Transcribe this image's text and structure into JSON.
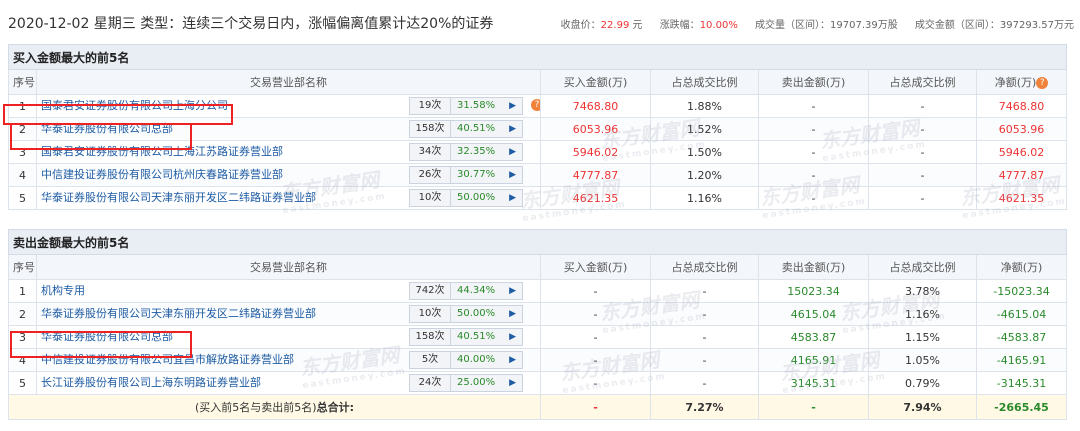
{
  "header": {
    "title": "2020-12-02 星期三  类型：连续三个交易日内，涨幅偏离值累计达20%的证券",
    "close_label": "收盘价：",
    "close_value": "22.99",
    "close_unit": "元",
    "change_label": "涨跌幅：",
    "change_value": "10.00%",
    "volume_label": "成交量（区间）：19707.39万股",
    "amount_label": "成交金额（区间）：397293.57万元"
  },
  "buy": {
    "section_title": "买入金额最大的前5名",
    "columns": [
      "序号",
      "交易营业部名称",
      "买入金额(万)",
      "占总成交比例",
      "卖出金额(万)",
      "占总成交比例",
      "净额(万)"
    ],
    "rows": [
      {
        "no": "1",
        "name": "国泰君安证券股份有限公司上海分公司",
        "count": "19次",
        "pct": "31.58%",
        "buy": "7468.80",
        "buy_ratio": "1.88%",
        "sell": "-",
        "sell_ratio": "-",
        "net": "7468.80"
      },
      {
        "no": "2",
        "name": "华泰证券股份有限公司总部",
        "count": "158次",
        "pct": "40.51%",
        "buy": "6053.96",
        "buy_ratio": "1.52%",
        "sell": "-",
        "sell_ratio": "-",
        "net": "6053.96"
      },
      {
        "no": "3",
        "name": "国泰君安证券股份有限公司上海江苏路证券营业部",
        "count": "34次",
        "pct": "32.35%",
        "buy": "5946.02",
        "buy_ratio": "1.50%",
        "sell": "-",
        "sell_ratio": "-",
        "net": "5946.02"
      },
      {
        "no": "4",
        "name": "中信建投证券股份有限公司杭州庆春路证券营业部",
        "count": "26次",
        "pct": "30.77%",
        "buy": "4777.87",
        "buy_ratio": "1.20%",
        "sell": "-",
        "sell_ratio": "-",
        "net": "4777.87"
      },
      {
        "no": "5",
        "name": "华泰证券股份有限公司天津东丽开发区二纬路证券营业部",
        "count": "10次",
        "pct": "50.00%",
        "buy": "4621.35",
        "buy_ratio": "1.16%",
        "sell": "-",
        "sell_ratio": "-",
        "net": "4621.35"
      }
    ]
  },
  "sell": {
    "section_title": "卖出金额最大的前5名",
    "columns": [
      "序号",
      "交易营业部名称",
      "买入金额(万)",
      "占总成交比例",
      "卖出金额(万)",
      "占总成交比例",
      "净额(万)"
    ],
    "rows": [
      {
        "no": "1",
        "name": "机构专用",
        "count": "742次",
        "pct": "44.34%",
        "buy": "-",
        "buy_ratio": "-",
        "sell": "15023.34",
        "sell_ratio": "3.78%",
        "net": "-15023.34"
      },
      {
        "no": "2",
        "name": "华泰证券股份有限公司天津东丽开发区二纬路证券营业部",
        "count": "10次",
        "pct": "50.00%",
        "buy": "-",
        "buy_ratio": "-",
        "sell": "4615.04",
        "sell_ratio": "1.16%",
        "net": "-4615.04"
      },
      {
        "no": "3",
        "name": "华泰证券股份有限公司总部",
        "count": "158次",
        "pct": "40.51%",
        "buy": "-",
        "buy_ratio": "-",
        "sell": "4583.87",
        "sell_ratio": "1.15%",
        "net": "-4583.87"
      },
      {
        "no": "4",
        "name": "中信建投证券股份有限公司宜昌市解放路证券营业部",
        "count": "5次",
        "pct": "40.00%",
        "buy": "-",
        "buy_ratio": "-",
        "sell": "4165.91",
        "sell_ratio": "1.05%",
        "net": "-4165.91"
      },
      {
        "no": "5",
        "name": "长江证券股份有限公司上海东明路证券营业部",
        "count": "24次",
        "pct": "25.00%",
        "buy": "-",
        "buy_ratio": "-",
        "sell": "3145.31",
        "sell_ratio": "0.79%",
        "net": "-3145.31"
      }
    ]
  },
  "total": {
    "label_prefix": "(买入前5名与卖出前5名)",
    "label_suffix": "总合计:",
    "buy": "-",
    "buy_ratio": "7.27%",
    "sell": "-",
    "sell_ratio": "7.94%",
    "net": "-2665.45"
  },
  "icons": {
    "question": "?",
    "play": "▶"
  },
  "watermark": {
    "cn": "东方财富网",
    "en": "eastmoney.com"
  },
  "colors": {
    "up": "#e33333",
    "down": "#2a8a2a",
    "link": "#1d5ba3",
    "highlight": "#e22222"
  }
}
